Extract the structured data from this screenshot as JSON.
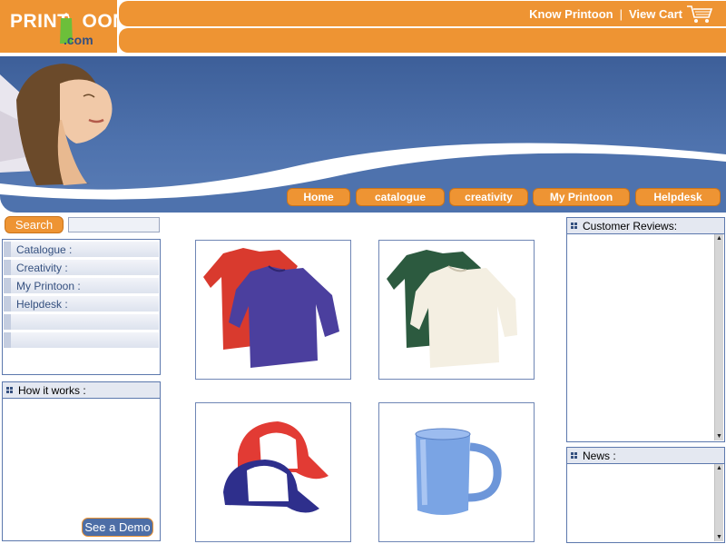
{
  "logo": {
    "word_print": "PRINT",
    "word_oon": "OON",
    "word_com": ".com"
  },
  "top_links": {
    "know": "Know Printoon",
    "separator": "|",
    "cart": "View Cart"
  },
  "nav": [
    "Home",
    "catalogue",
    "creativity",
    "My Printoon",
    "Helpdesk"
  ],
  "search": {
    "button": "Search",
    "value": ""
  },
  "left_menu": [
    "Catalogue :",
    "Creativity :",
    "My Printoon :",
    "Helpdesk :",
    "",
    ""
  ],
  "how_it_works": {
    "title": "How it works :",
    "demo_button": "See a Demo"
  },
  "reviews": {
    "title": "Customer Reviews:"
  },
  "news": {
    "title": "News :"
  },
  "colors": {
    "orange": "#ee9433",
    "blue": "#4e72ad",
    "navy": "#35507f"
  },
  "icons": [
    "cart-icon",
    "grip-dots-icon",
    "scroll-up-arrow",
    "scroll-down-arrow"
  ],
  "products": [
    {
      "name": "red-and-purple-long-sleeve-shirts"
    },
    {
      "name": "green-and-cream-long-sleeve-shirts"
    },
    {
      "name": "red-white-and-blue-caps"
    },
    {
      "name": "blue-mug"
    }
  ]
}
